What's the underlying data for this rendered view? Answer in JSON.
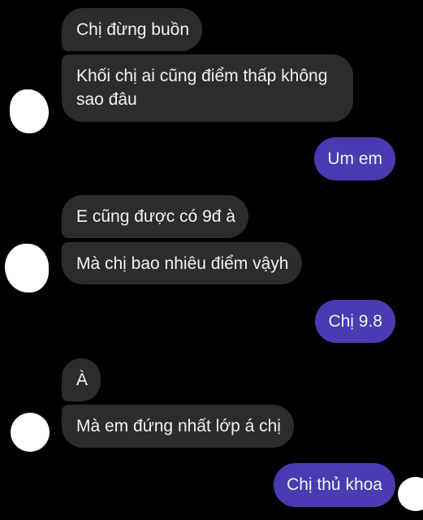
{
  "messages": [
    {
      "side": "incoming",
      "text": "Chị đừng buồn"
    },
    {
      "side": "incoming",
      "text": "Khối chị ai cũng điểm thấp không sao đâu"
    },
    {
      "side": "outgoing",
      "text": "Um em"
    },
    {
      "side": "incoming",
      "text": "E cũng được có 9đ à"
    },
    {
      "side": "incoming",
      "text": "Mà chị bao nhiêu điểm vậyh"
    },
    {
      "side": "outgoing",
      "text": "Chị 9.8"
    },
    {
      "side": "incoming",
      "text": "À"
    },
    {
      "side": "incoming",
      "text": "Mà em đứng nhất lớp á chị"
    },
    {
      "side": "outgoing",
      "text": "Chị thủ khoa"
    }
  ],
  "colors": {
    "incoming_bubble": "#2c2c2e",
    "outgoing_bubble": "#4a3bb2",
    "background": "#000000"
  }
}
